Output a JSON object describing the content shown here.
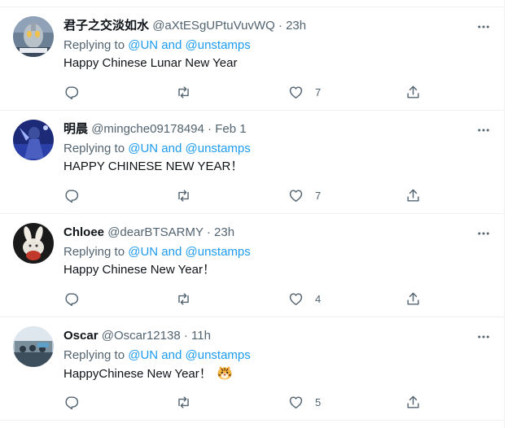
{
  "reply_prefix": "Replying to",
  "mention_and": "and",
  "tweets": [
    {
      "display_name": "君子之交淡如水",
      "handle": "@aXtESgUPtuVuvWQ",
      "dot": "·",
      "time": "23h",
      "mentions": [
        "@UN",
        "@unstamps"
      ],
      "text": "Happy Chinese Lunar New Year",
      "like_count": "7",
      "avatar": "anime-hero-icon"
    },
    {
      "display_name": "明晨",
      "handle": "@mingche09178494",
      "dot": "·",
      "time": "Feb 1",
      "mentions": [
        "@UN",
        "@unstamps"
      ],
      "text": "HAPPY CHINESE NEW YEAR！",
      "like_count": "7",
      "avatar": "blue-figure-icon"
    },
    {
      "display_name": "Chloee",
      "handle": "@dearBTSARMY",
      "dot": "·",
      "time": "23h",
      "mentions": [
        "@UN",
        "@unstamps"
      ],
      "text": "Happy Chinese New Year！",
      "like_count": "4",
      "avatar": "bunny-icon"
    },
    {
      "display_name": "Oscar",
      "handle": "@Oscar12138",
      "dot": "·",
      "time": "11h",
      "mentions": [
        "@UN",
        "@unstamps"
      ],
      "text": "HappyChinese New Year！",
      "emoji": "tiger-face-emoji",
      "like_count": "5",
      "avatar": "crowd-photo-icon"
    }
  ],
  "colors": {
    "accent": "#1d9bf0",
    "secondary_text": "#536471",
    "primary_text": "#0f1419",
    "divider": "#eff3f4"
  }
}
